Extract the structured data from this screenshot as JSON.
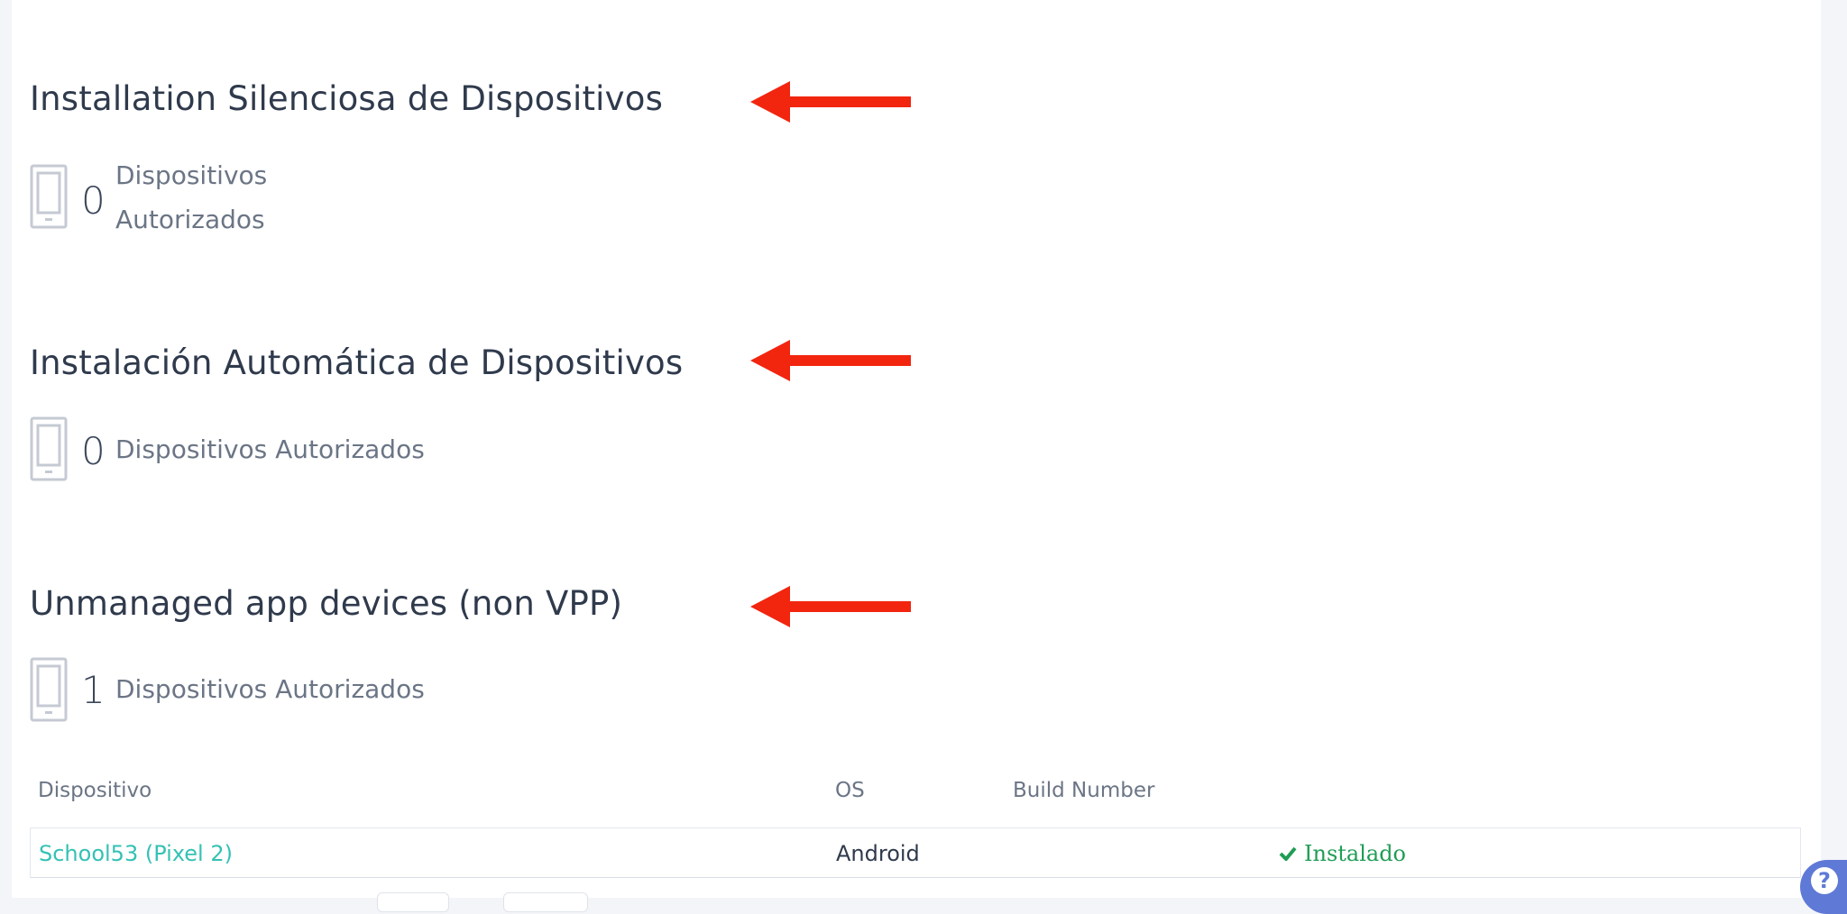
{
  "sections": [
    {
      "title": "Installation Silenciosa de Dispositivos",
      "count": "0",
      "label_line1": "Dispositivos",
      "label_line2": "Autorizados"
    },
    {
      "title": "Instalación Automática de Dispositivos",
      "count": "0",
      "label": "Dispositivos Autorizados"
    },
    {
      "title": "Unmanaged app devices (non VPP)",
      "count": "1",
      "label": "Dispositivos Autorizados"
    }
  ],
  "table": {
    "headers": {
      "device": "Dispositivo",
      "os": "OS",
      "build": "Build Number"
    },
    "rows": [
      {
        "device": "School53 (Pixel 2)",
        "os": "Android",
        "build": "",
        "status": "Instalado"
      }
    ]
  },
  "icons": {
    "device": "mobile-phone-icon",
    "status": "checkmark-icon",
    "annotation": "red-arrow-icon",
    "help": "help-icon"
  },
  "colors": {
    "arrow": "#f2250f",
    "link": "#35c1b5",
    "installed": "#1f9d55",
    "help_button": "#5f79d6"
  },
  "help": {
    "label": "?"
  }
}
